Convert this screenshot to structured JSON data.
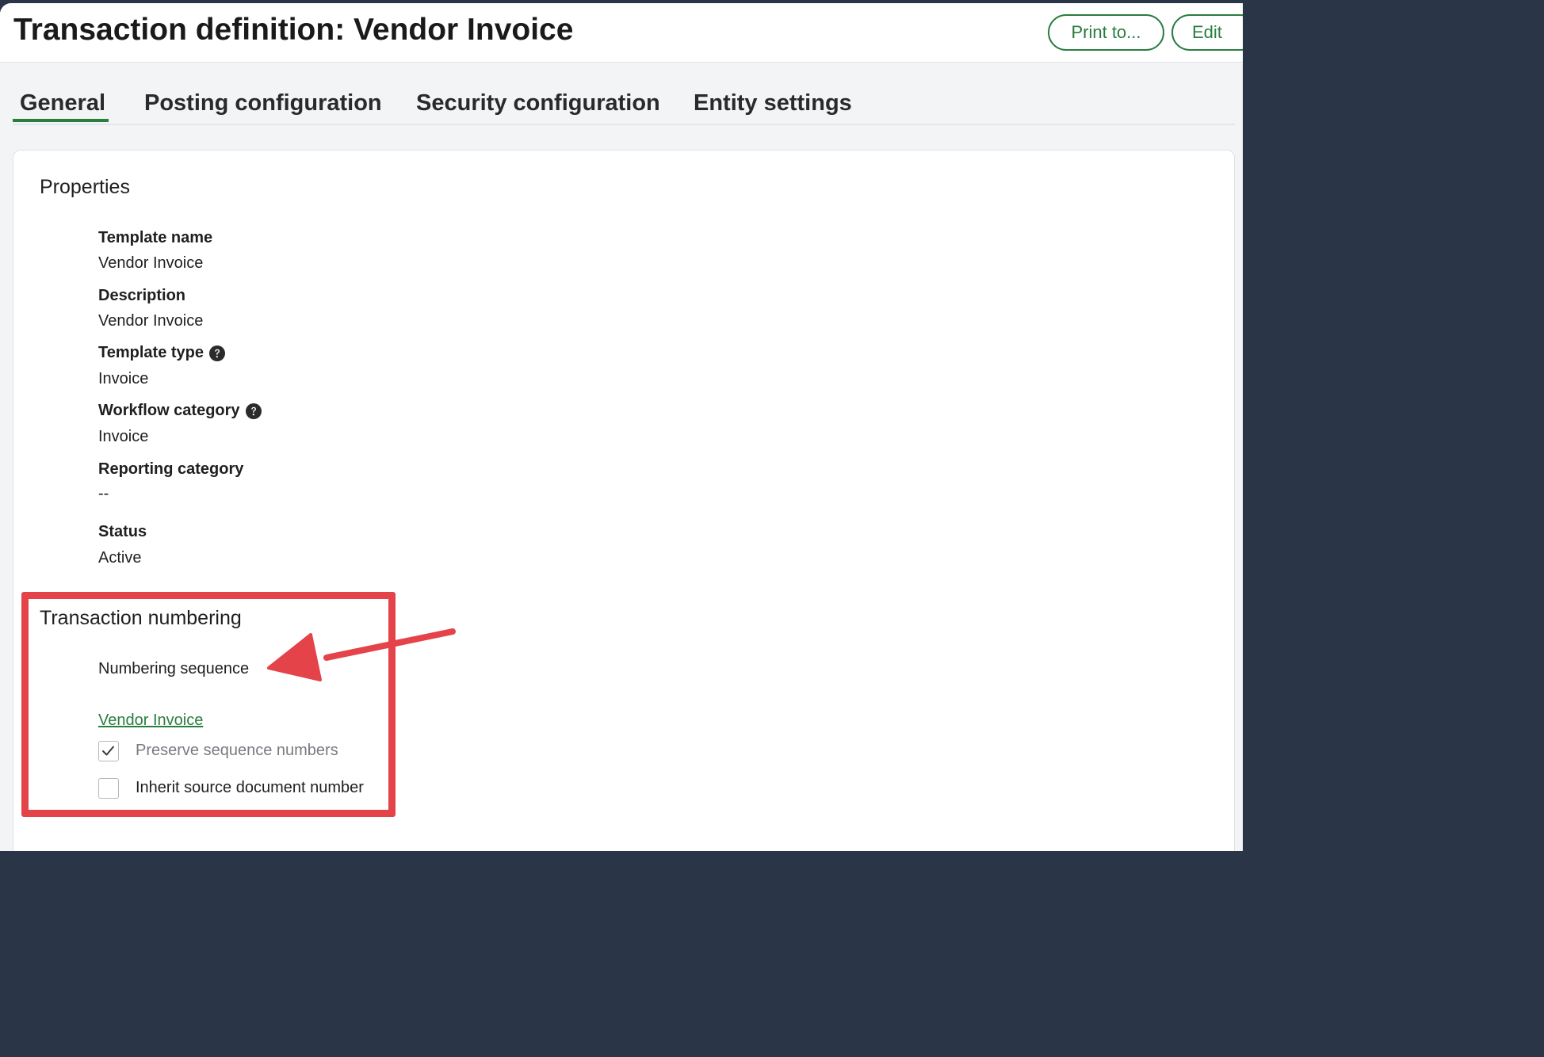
{
  "header": {
    "title": "Transaction definition: Vendor Invoice",
    "print_label": "Print to...",
    "edit_label": "Edit"
  },
  "tabs": [
    {
      "label": "General",
      "active": true
    },
    {
      "label": "Posting configuration",
      "active": false
    },
    {
      "label": "Security configuration",
      "active": false
    },
    {
      "label": "Entity settings",
      "active": false
    }
  ],
  "properties": {
    "title": "Properties",
    "fields": [
      {
        "label": "Template name",
        "value": "Vendor Invoice",
        "help": false
      },
      {
        "label": "Description",
        "value": "Vendor Invoice",
        "help": false
      },
      {
        "label": "Template type",
        "value": "Invoice",
        "help": true
      },
      {
        "label": "Workflow category",
        "value": "Invoice",
        "help": true
      },
      {
        "label": "Reporting category",
        "value": "--",
        "help": false
      },
      {
        "label": "Status",
        "value": "Active",
        "help": false
      }
    ]
  },
  "numbering": {
    "title": "Transaction numbering",
    "sequence_label": "Numbering sequence",
    "sequence_link": "Vendor Invoice",
    "preserve": {
      "label": "Preserve sequence numbers",
      "checked": true,
      "disabled": true
    },
    "inherit": {
      "label": "Inherit source document number",
      "checked": false,
      "disabled": false
    }
  },
  "colors": {
    "accent": "#2a7d3f",
    "annotation": "#e4434a"
  },
  "icons": {
    "help": "question-circle-icon",
    "check": "checkmark-icon",
    "annotation_arrow": "arrow-icon"
  }
}
